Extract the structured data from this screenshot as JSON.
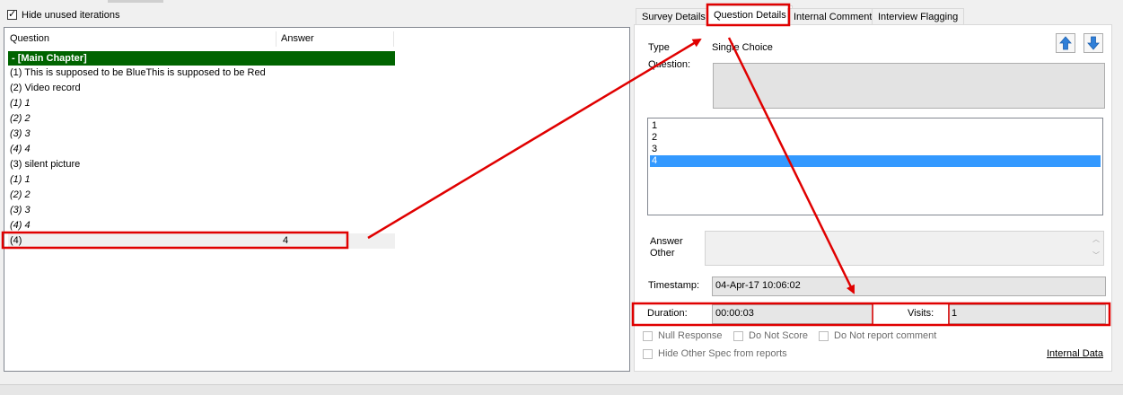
{
  "top": {
    "hide_unused_label": "Hide unused iterations"
  },
  "grid": {
    "col_question": "Question",
    "col_answer": "Answer",
    "chapter": "- [Main Chapter]",
    "rows": [
      {
        "q": "(1) This is supposed to be BlueThis is supposed to be Red",
        "a": ""
      },
      {
        "q": "(2) Video record",
        "a": ""
      },
      {
        "q": "(1) 1",
        "a": ""
      },
      {
        "q": "(2) 2",
        "a": ""
      },
      {
        "q": "(3) 3",
        "a": ""
      },
      {
        "q": "(4) 4",
        "a": ""
      },
      {
        "q": "(3) silent picture",
        "a": ""
      },
      {
        "q": "(1) 1",
        "a": ""
      },
      {
        "q": "(2) 2",
        "a": ""
      },
      {
        "q": "(3) 3",
        "a": ""
      },
      {
        "q": "(4) 4",
        "a": ""
      },
      {
        "q": "(4)",
        "a": "4"
      }
    ]
  },
  "tabs": [
    "Survey Details",
    "Question Details",
    "Internal Comment",
    "Interview Flagging"
  ],
  "details": {
    "type_label": "Type",
    "type_value": "Single Choice",
    "question_label": "Question:",
    "options": [
      "1",
      "2",
      "3",
      "4"
    ],
    "answer_label": "Answer",
    "other_label": "Other",
    "timestamp_label": "Timestamp:",
    "timestamp_value": "04-Apr-17 10:06:02",
    "duration_label": "Duration:",
    "duration_value": "00:00:03",
    "visits_label": "Visits:",
    "visits_value": "1",
    "null_response": "Null Response",
    "do_not_score": "Do Not Score",
    "do_not_report": "Do Not report comment",
    "hide_other_spec": "Hide Other Spec from reports",
    "internal_data": "Internal Data"
  },
  "colors": {
    "chapter_bg": "#006400",
    "selection": "#3399ff",
    "annotation": "#e00000"
  },
  "icons": {
    "up": "arrow-up-icon",
    "down": "arrow-down-icon"
  }
}
